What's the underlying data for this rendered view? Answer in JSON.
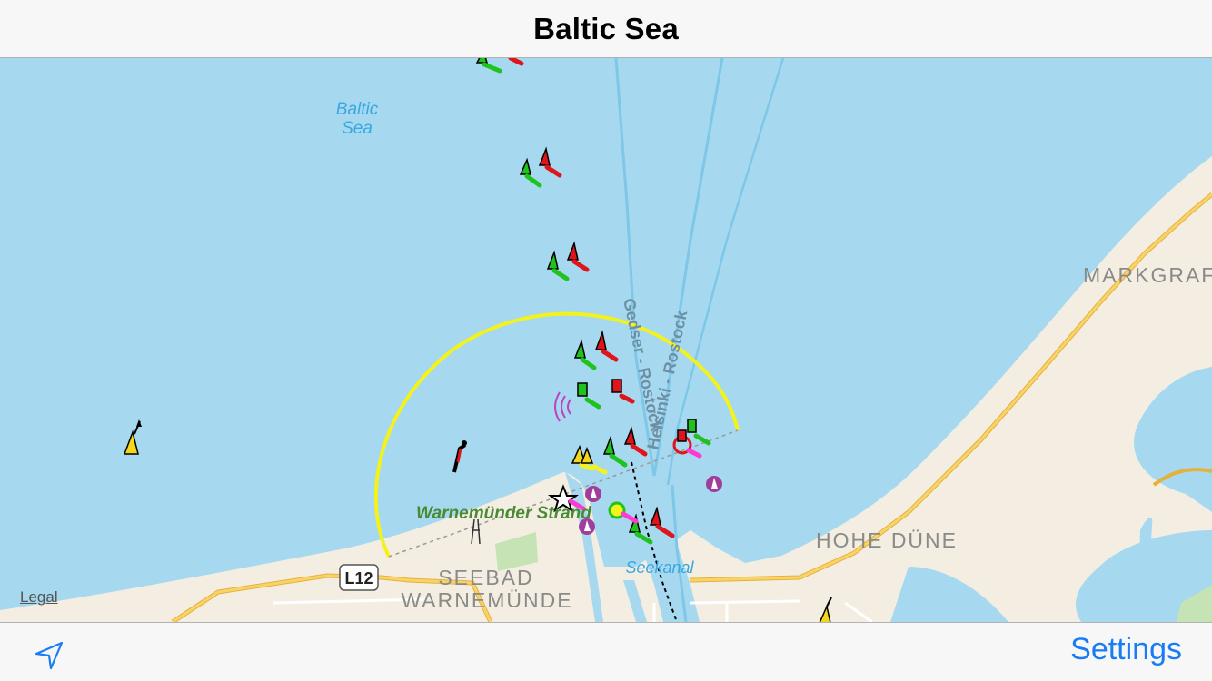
{
  "nav": {
    "title": "Baltic Sea"
  },
  "map": {
    "labels": {
      "sea": [
        "Baltic",
        "Sea"
      ],
      "beach": "Warnemünder Strand",
      "town": [
        "SEEBAD",
        "WARNEMÜNDE"
      ],
      "district": "HOHE DÜNE",
      "district_east": "MARKGRAF",
      "canal": "Seekanal",
      "ferry_1": "Gedser - Rostock",
      "ferry_2": "Helsinki - Rostock",
      "road_shield": "L12"
    },
    "legal": "Legal",
    "colors": {
      "water": "#a6d9ef",
      "land": "#f4eee2",
      "road": "#f8c54c",
      "sector_light": "#f4f21c"
    }
  },
  "toolbar": {
    "location_icon": "location-arrow-icon",
    "settings_label": "Settings"
  }
}
